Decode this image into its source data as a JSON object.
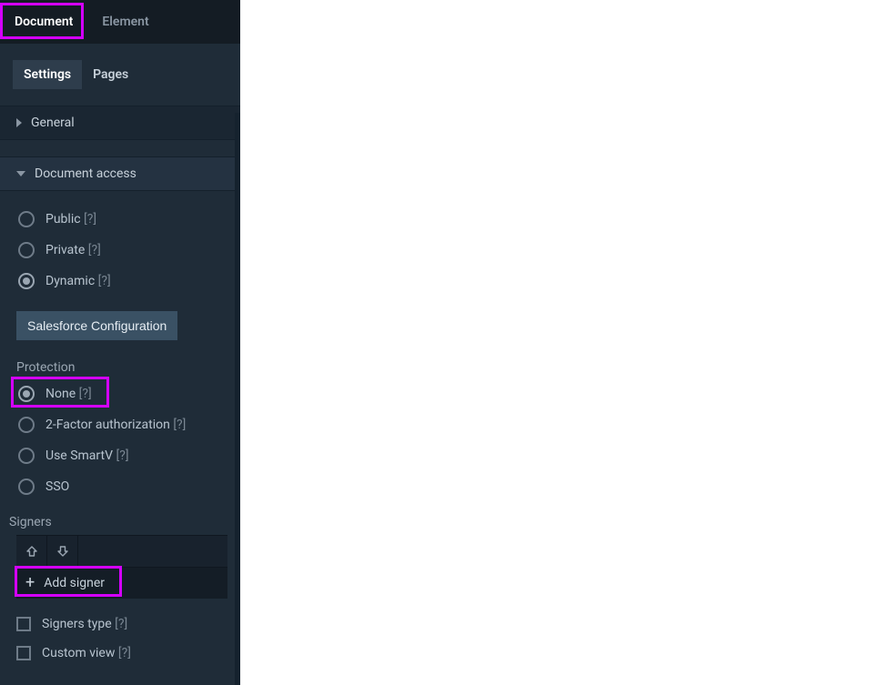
{
  "topTabs": {
    "document": "Document",
    "element": "Element"
  },
  "subTabs": {
    "settings": "Settings",
    "pages": "Pages"
  },
  "sections": {
    "general": "General",
    "documentAccess": "Document access"
  },
  "access": {
    "public": "Public",
    "private": "Private",
    "dynamic": "Dynamic"
  },
  "help": "[?]",
  "salesforceBtn": "Salesforce Configuration",
  "protectionLabel": "Protection",
  "protection": {
    "none": "None",
    "twoFactor": "2-Factor authorization",
    "smartv": "Use SmartV",
    "sso": "SSO"
  },
  "signersLabel": "Signers",
  "addSigner": "Add signer",
  "signersOptions": {
    "signersType": "Signers type",
    "customView": "Custom view"
  }
}
